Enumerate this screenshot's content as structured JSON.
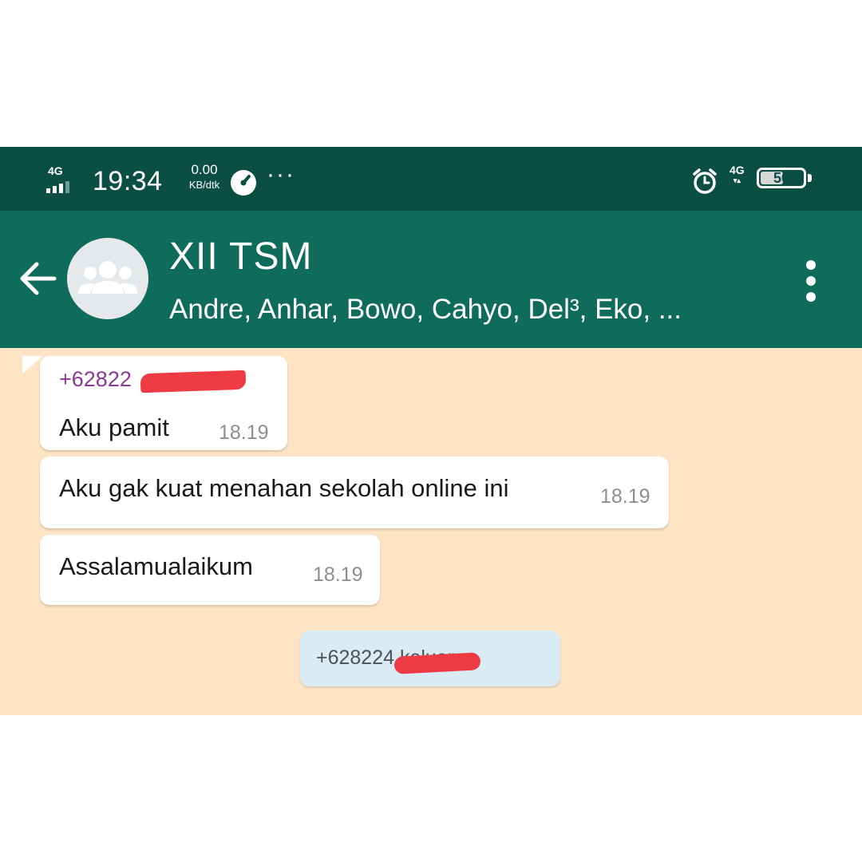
{
  "status_bar": {
    "network_left": "4G",
    "time": "19:34",
    "speed_value": "0.00",
    "speed_unit": "KB/dtk",
    "network_right": "4G",
    "battery_level": "50"
  },
  "header": {
    "title": "XII TSM",
    "members": "Andre, Anhar, Bowo, Cahyo, Del³, Eko, ..."
  },
  "messages": [
    {
      "sender": "+62822",
      "text": "Aku pamit",
      "time": "18.19"
    },
    {
      "text": "Aku gak kuat menahan sekolah online ini",
      "time": "18.19"
    },
    {
      "text": "Assalamualaikum",
      "time": "18.19"
    }
  ],
  "system_note": {
    "text": "+628224 keluar"
  },
  "colors": {
    "status_bar": "#0b4f43",
    "header": "#0f6b5a",
    "chat_background": "#fde4c4",
    "sender_name": "#8a3a96",
    "system_note": "#d9ecf4",
    "redaction": "#ee3a43"
  },
  "icons": {
    "back": "arrow-left-icon",
    "avatar": "group-avatar-icon",
    "menu": "vertical-dots-icon",
    "alarm": "alarm-clock-icon",
    "battery": "battery-icon"
  }
}
